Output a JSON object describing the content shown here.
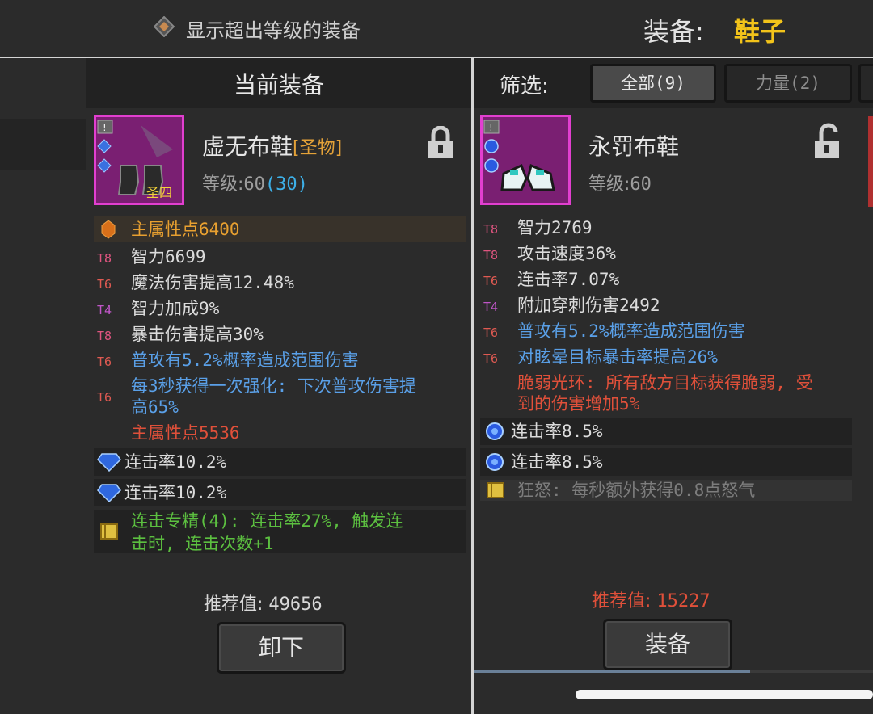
{
  "topbar": {
    "toggle_label": "显示超出等级的装备",
    "equip_title": "装备:",
    "equip_slot": "鞋子"
  },
  "current": {
    "header": "当前装备",
    "item": {
      "name": "虚无布鞋",
      "rarity": "[圣物]",
      "level_label": "等级:",
      "level": "60",
      "level_extra": "(30)",
      "badge": "圣四"
    },
    "main_stat": "主属性点6400",
    "stats": [
      {
        "tier": "T8",
        "text": "智力6699",
        "color": "normal"
      },
      {
        "tier": "T6",
        "text": "魔法伤害提高12.48%",
        "color": "normal"
      },
      {
        "tier": "T4",
        "text": "智力加成9%",
        "color": "normal"
      },
      {
        "tier": "T8",
        "text": "暴击伤害提高30%",
        "color": "normal"
      },
      {
        "tier": "T6",
        "text": "普攻有5.2%概率造成范围伤害",
        "color": "blue"
      },
      {
        "tier": "T6",
        "text": "每3秒获得一次强化: 下次普攻伤害提",
        "text2": "高65%",
        "color": "blue"
      }
    ],
    "bonus_stat": "主属性点5536",
    "gems": [
      "连击率10.2%",
      "连击率10.2%"
    ],
    "set_bonus_line1": "连击专精(4): 连击率27%, 触发连",
    "set_bonus_line2": "击时, 连击次数+1",
    "score_label": "推荐值:",
    "score": "49656",
    "unequip_button": "卸下"
  },
  "filter": {
    "label": "筛选:",
    "tabs": [
      "全部(9)",
      "力量(2)"
    ]
  },
  "candidate": {
    "item": {
      "name": "永罚布鞋",
      "level_label": "等级:",
      "level": "60"
    },
    "stats": [
      {
        "tier": "T8",
        "text": "智力2769"
      },
      {
        "tier": "T8",
        "text": "攻击速度36%"
      },
      {
        "tier": "T6",
        "text": "连击率7.07%"
      },
      {
        "tier": "T4",
        "text": "附加穿刺伤害2492"
      },
      {
        "tier": "T6",
        "text": "普攻有5.2%概率造成范围伤害"
      },
      {
        "tier": "T6",
        "text": "对眩晕目标暴击率提高26%"
      }
    ],
    "aura_line1": "脆弱光环: 所有敌方目标获得脆弱, 受",
    "aura_line2": "到的伤害增加5%",
    "gems": [
      "连击率8.5%",
      "连击率8.5%"
    ],
    "set_bonus": "狂怒: 每秒额外获得0.8点怒气",
    "score_label": "推荐值:",
    "score": "15227",
    "equip_button": "装备"
  },
  "colors": {
    "accent_gold": "#f2c31a",
    "rarity_orange": "#e4a238",
    "level_blue": "#3db0e8",
    "item_frame": "#e23fd0",
    "item_bg": "#7a1f72",
    "stat_blue": "#5aa0e8",
    "stat_red": "#e0503a",
    "set_green": "#5cc040"
  }
}
